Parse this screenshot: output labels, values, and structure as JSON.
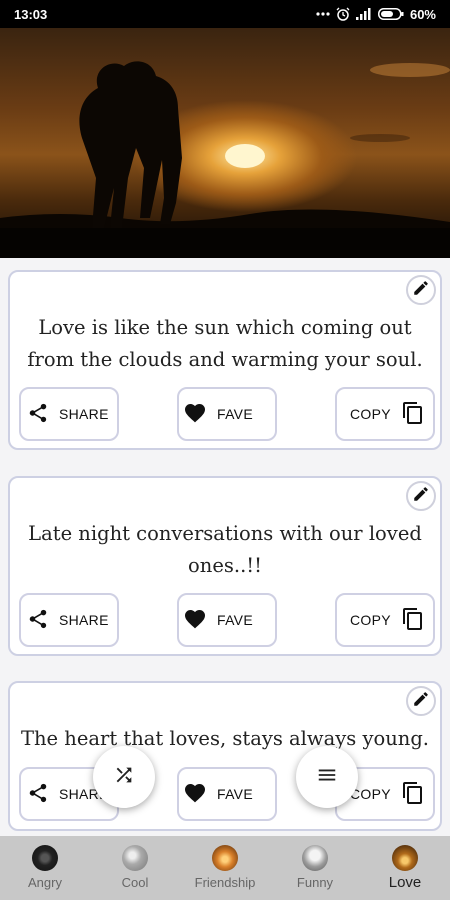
{
  "status_bar": {
    "time": "13:03",
    "battery": "60%"
  },
  "quotes": [
    {
      "text": "Love is like the sun which coming out from the clouds and warming your soul."
    },
    {
      "text": "Late night conversations with our loved ones..!!"
    },
    {
      "text": "The heart that loves, stays always young."
    }
  ],
  "buttons": {
    "share": "SHARE",
    "fave": "FAVE",
    "copy": "COPY"
  },
  "nav": [
    {
      "label": "Angry",
      "active": false
    },
    {
      "label": "Cool",
      "active": false
    },
    {
      "label": "Friendship",
      "active": false
    },
    {
      "label": "Funny",
      "active": false
    },
    {
      "label": "Love",
      "active": true
    }
  ],
  "colors": {
    "card_border": "#cdd0e3",
    "nav_bg": "#c8c8c8",
    "status_bg": "#000000"
  }
}
